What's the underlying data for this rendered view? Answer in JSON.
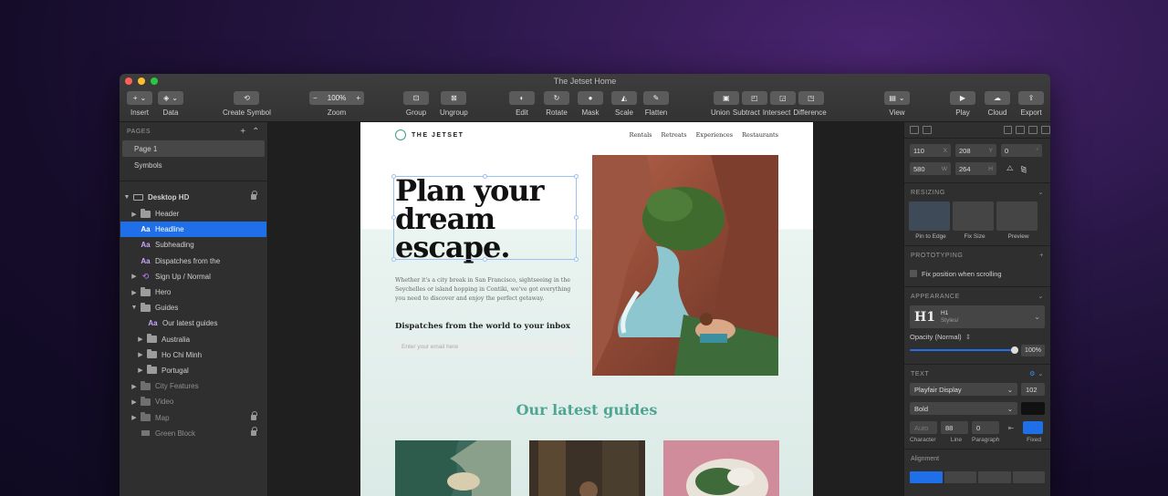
{
  "window": {
    "title": "The Jetset Home"
  },
  "toolbar": {
    "insert": "Insert",
    "data": "Data",
    "create_symbol": "Create Symbol",
    "zoom_label": "Zoom",
    "zoom_value": "100%",
    "zoom_minus": "−",
    "zoom_plus": "+",
    "group": "Group",
    "ungroup": "Ungroup",
    "edit": "Edit",
    "rotate": "Rotate",
    "mask": "Mask",
    "scale": "Scale",
    "flatten": "Flatten",
    "union": "Union",
    "subtract": "Subtract",
    "intersect": "Intersect",
    "difference": "Difference",
    "view": "View",
    "play": "Play",
    "cloud": "Cloud",
    "export": "Export"
  },
  "pages": {
    "header": "PAGES",
    "items": [
      "Page 1",
      "Symbols"
    ]
  },
  "layers": {
    "artboard": "Desktop HD",
    "items": [
      {
        "label": "Header",
        "kind": "folder"
      },
      {
        "label": "Headline",
        "kind": "text"
      },
      {
        "label": "Subheading",
        "kind": "text"
      },
      {
        "label": "Dispatches from the",
        "kind": "text"
      },
      {
        "label": "Sign Up / Normal",
        "kind": "symbol"
      },
      {
        "label": "Hero",
        "kind": "folder"
      },
      {
        "label": "Guides",
        "kind": "folder"
      },
      {
        "label": "Our latest guides",
        "kind": "text"
      },
      {
        "label": "Australia",
        "kind": "folder"
      },
      {
        "label": "Ho Chi Minh",
        "kind": "folder"
      },
      {
        "label": "Portugal",
        "kind": "folder"
      },
      {
        "label": "City Features",
        "kind": "folder"
      },
      {
        "label": "Video",
        "kind": "folder"
      },
      {
        "label": "Map",
        "kind": "folder"
      },
      {
        "label": "Green Block",
        "kind": "rect"
      }
    ]
  },
  "site": {
    "logo": "THE JETSET",
    "nav": [
      "Rentals",
      "Retreats",
      "Experiences",
      "Restaurants"
    ],
    "headline": [
      "Plan your",
      "dream",
      "escape."
    ],
    "body": "Whether it's a city break in San Francisco, sightseeing in the Seychelles or island hopping in Contiki, we've got everything you need to discover and enjoy the perfect getaway.",
    "dispatch": "Dispatches from the world to your inbox",
    "email_placeholder": "Enter your email here",
    "guides_title": "Our latest guides"
  },
  "inspector": {
    "x": "110",
    "x_unit": "X",
    "y": "208",
    "y_unit": "Y",
    "rotation": "0",
    "rotation_unit": "°",
    "w": "580",
    "w_unit": "W",
    "h": "264",
    "h_unit": "H",
    "resizing": "RESIZING",
    "pin_to_edge": "Pin to Edge",
    "fix_size": "Fix Size",
    "preview": "Preview",
    "prototyping": "PROTOTYPING",
    "fix_position": "Fix position when scrolling",
    "appearance": "APPEARANCE",
    "style_glyph": "H1",
    "style_name": "H1",
    "style_path": "Styles/",
    "opacity_label": "Opacity (Normal)",
    "opacity_value": "100%",
    "text": "TEXT",
    "font_family": "Playfair Display",
    "font_size": "102",
    "font_weight": "Bold",
    "char_value": "Auto",
    "line_value": "88",
    "para_value": "0",
    "character": "Character",
    "line": "Line",
    "paragraph": "Paragraph",
    "fixed": "Fixed",
    "alignment": "Alignment"
  },
  "colors": {
    "accent": "#1e6fe8",
    "brand_teal": "#4ea593"
  }
}
